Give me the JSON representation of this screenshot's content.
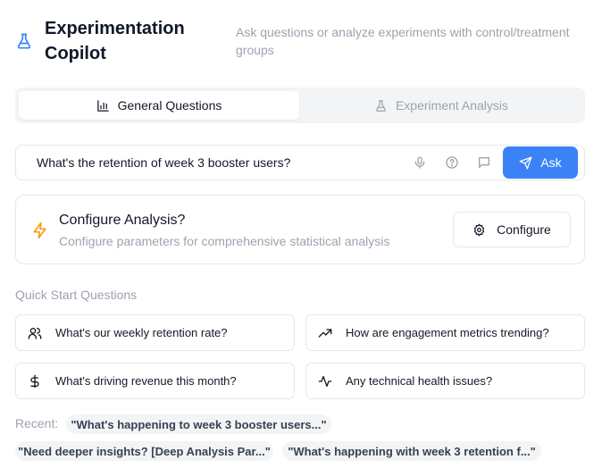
{
  "header": {
    "title": "Experimentation Copilot",
    "subtitle": "Ask questions or analyze experiments with control/treatment groups",
    "icon": "flask-icon",
    "accent": "#3b82f6"
  },
  "tabs": [
    {
      "label": "General Questions",
      "icon": "bar-chart-icon",
      "active": true
    },
    {
      "label": "Experiment Analysis",
      "icon": "flask-icon",
      "active": false
    }
  ],
  "ask": {
    "value": "What's the retention of week 3 booster users?",
    "button_label": "Ask",
    "button_color": "#3b82f6"
  },
  "configure": {
    "title": "Configure Analysis?",
    "description": "Configure parameters for comprehensive statistical analysis",
    "button_label": "Configure",
    "icon_color": "#f59e0b"
  },
  "quick_start": {
    "label": "Quick Start Questions",
    "questions": [
      {
        "label": "What's our weekly retention rate?",
        "icon": "users-icon"
      },
      {
        "label": "How are engagement metrics trending?",
        "icon": "trending-up-icon"
      },
      {
        "label": "What's driving revenue this month?",
        "icon": "dollar-icon"
      },
      {
        "label": "Any technical health issues?",
        "icon": "activity-icon"
      }
    ]
  },
  "recent": {
    "label": "Recent:",
    "items": [
      "\"What's happening to week 3 booster users...\"",
      "\"Need deeper insights? [Deep Analysis Par...\"",
      "\"What's happening with week 3 retention f...\""
    ]
  }
}
